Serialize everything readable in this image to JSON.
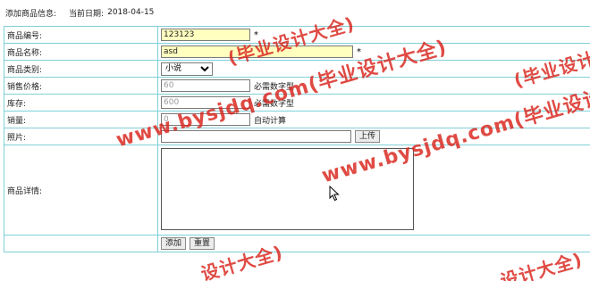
{
  "header": {
    "title": "添加商品信息:",
    "date_label": "当前日期:",
    "date_value": "2018-04-15"
  },
  "form": {
    "rows": {
      "code": {
        "label": "商品编号:",
        "value": "123123",
        "suffix": "*"
      },
      "name": {
        "label": "商品名称:",
        "value": "asd",
        "suffix": "*"
      },
      "category": {
        "label": "商品类别:",
        "selected": "小说"
      },
      "price": {
        "label": "销售价格:",
        "value": "60",
        "hint": "必需数字型"
      },
      "stock": {
        "label": "库存:",
        "value": "600",
        "hint": "必需数字型"
      },
      "sales": {
        "label": "销量:",
        "value": "0",
        "hint": "自动计算"
      },
      "photo": {
        "label": "照片:",
        "value": "",
        "upload_label": "上传"
      },
      "detail": {
        "label": "商品详情:",
        "value": ""
      }
    },
    "buttons": {
      "add": "添加",
      "reset": "重置"
    }
  },
  "watermarks": {
    "wm1": "www.bysjdq.com(毕业设计大全)",
    "wm2": "www.bysjdq.com(毕业设计大全)",
    "wm3": "设计大全)",
    "wm4": "(毕业设计大全)",
    "wm5": "(毕业设计",
    "wm6": "设计大全)"
  },
  "colors": {
    "table_border": "#7fd0d8",
    "required_field_bg": "#ffffc0",
    "watermark": "#d9241c"
  }
}
